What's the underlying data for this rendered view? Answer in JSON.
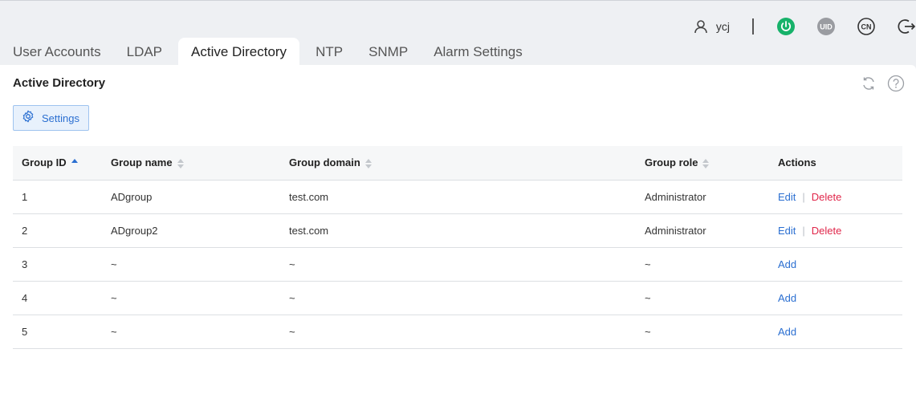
{
  "header": {
    "username": "ycj",
    "icons": [
      "user-icon",
      "power-icon",
      "uid-icon",
      "cn-icon",
      "logout-icon"
    ],
    "power_color": "#17b26a",
    "uid_label": "UID",
    "cn_label": "CN"
  },
  "tabs": [
    {
      "label": "User Accounts",
      "active": false
    },
    {
      "label": "LDAP",
      "active": false
    },
    {
      "label": "Active Directory",
      "active": true
    },
    {
      "label": "NTP",
      "active": false
    },
    {
      "label": "SNMP",
      "active": false
    },
    {
      "label": "Alarm Settings",
      "active": false
    }
  ],
  "panel": {
    "title": "Active Directory",
    "settings_label": "Settings",
    "tool_icons": [
      "refresh-icon",
      "help-icon"
    ]
  },
  "table": {
    "columns": [
      "Group ID",
      "Group name",
      "Group domain",
      "Group role",
      "Actions"
    ],
    "sort_column": "Group ID",
    "sort_direction": "ascending",
    "rows": [
      {
        "id": "1",
        "name": "ADgroup",
        "domain": "test.com",
        "role": "Administrator",
        "edit": "Edit",
        "delete": "Delete",
        "sep": "|"
      },
      {
        "id": "2",
        "name": "ADgroup2",
        "domain": "test.com",
        "role": "Administrator",
        "edit": "Edit",
        "delete": "Delete",
        "sep": "|"
      },
      {
        "id": "3",
        "name": "~",
        "domain": "~",
        "role": "~",
        "add": "Add"
      },
      {
        "id": "4",
        "name": "~",
        "domain": "~",
        "role": "~",
        "add": "Add"
      },
      {
        "id": "5",
        "name": "~",
        "domain": "~",
        "role": "~",
        "add": "Add"
      }
    ]
  },
  "colors": {
    "accent": "#2b6fd1",
    "danger": "#e0264a"
  }
}
